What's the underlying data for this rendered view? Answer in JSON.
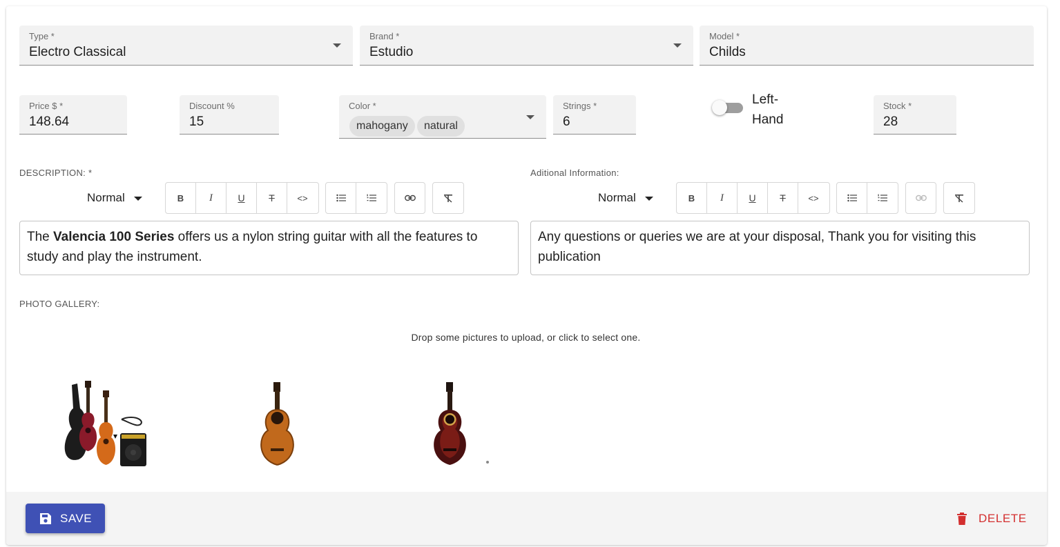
{
  "fields": {
    "type": {
      "label": "Type *",
      "value": "Electro Classical"
    },
    "brand": {
      "label": "Brand *",
      "value": "Estudio"
    },
    "model": {
      "label": "Model *",
      "value": "Childs"
    },
    "price": {
      "label": "Price $ *",
      "value": "148.64"
    },
    "discount": {
      "label": "Discount %",
      "value": "15"
    },
    "color": {
      "label": "Color *",
      "chips": [
        "mahogany",
        "natural"
      ]
    },
    "strings": {
      "label": "Strings *",
      "value": "6"
    },
    "left_hand": {
      "label": "Left-Hand",
      "checked": false
    },
    "stock": {
      "label": "Stock *",
      "value": "28"
    }
  },
  "description": {
    "label": "DESCRIPTION: *",
    "format_select": "Normal",
    "text_bold": "Valencia 100 Series",
    "text_before": "The ",
    "text_after": " offers us a nylon string guitar with all the features to study and play the instrument."
  },
  "additional": {
    "label": "Aditional Information:",
    "format_select": "Normal",
    "text": "Any questions or queries we are at your disposal, Thank you for visiting this publication"
  },
  "gallery": {
    "label": "PHOTO GALLERY:",
    "drop_text": "Drop some pictures to upload, or click to select one.",
    "photos": [
      "guitar-kit-photo",
      "natural-guitar-photo",
      "mahogany-guitar-photo"
    ]
  },
  "actions": {
    "save": "SAVE",
    "delete": "DELETE"
  },
  "colors": {
    "primary": "#3f51b5",
    "danger": "#d32f2f",
    "field_bg": "#f2f2f2"
  }
}
